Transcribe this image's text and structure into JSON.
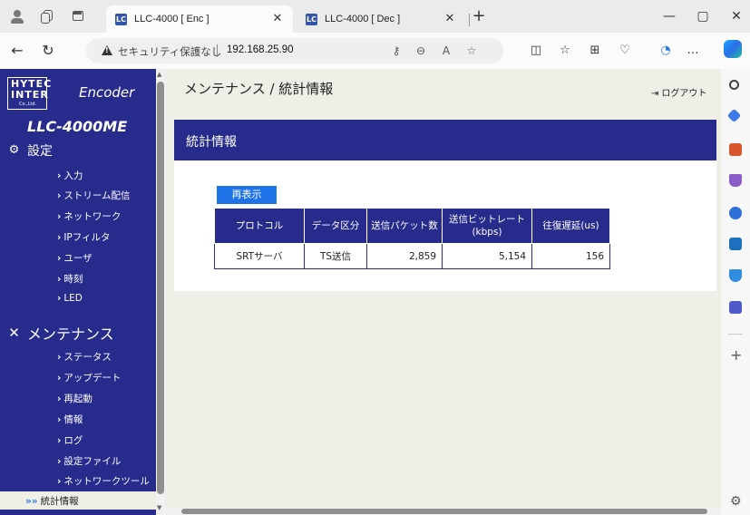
{
  "browser": {
    "tabs": [
      {
        "title": "LLC-4000 [ Enc ]",
        "favicon": "LC",
        "close": "✕"
      },
      {
        "title": "LLC-4000 [ Dec ]",
        "favicon": "LC",
        "close": "✕"
      }
    ],
    "new_tab": "+",
    "window_controls": {
      "minimize": "—",
      "maximize": "▢",
      "close": "✕"
    },
    "nav": {
      "back": "←",
      "reload": "↻"
    },
    "address": {
      "security_label": "セキュリティ保護なし",
      "url": "192.168.25.90"
    },
    "address_icons": {
      "key": "⚷",
      "zoom": "⊖",
      "read_aloud": "A",
      "favorite": "☆"
    },
    "toolbar_icons": {
      "split": "◫",
      "favorites": "☆",
      "collections": "⊞",
      "health": "♡",
      "performance": "◔",
      "more": "…"
    }
  },
  "sidebar": {
    "logo_line1": "HYTEC",
    "logo_line2": "INTER",
    "logo_line3": "Co.,Ltd.",
    "encoder_label": "Encoder",
    "model": "LLC-4000ME",
    "settings_heading": "設定",
    "settings_items": [
      "入力",
      "ストリーム配信",
      "ネットワーク",
      "IPフィルタ",
      "ユーザ",
      "時刻",
      "LED"
    ],
    "maintenance_heading": "メンテナンス",
    "maintenance_items": [
      "ステータス",
      "アップデート",
      "再起動",
      "情報",
      "ログ",
      "設定ファイル",
      "ネットワークツール"
    ],
    "current_item": "統計情報",
    "current_marker": "»»"
  },
  "main": {
    "breadcrumb": "メンテナンス / 統計情報",
    "logout": "ログアウト",
    "panel_title": "統計情報",
    "refresh_button": "再表示",
    "table": {
      "headers": [
        "プロトコル",
        "データ区分",
        "送信パケット数",
        "送信ビットレート",
        "(kbps)",
        "往復遅延(us)"
      ],
      "rows": [
        [
          "SRTサーバ",
          "TS送信",
          "2,859",
          "5,154",
          "156"
        ]
      ]
    }
  },
  "colors": {
    "brand": "#262b8c",
    "button": "#1e73e8",
    "page_bg": "#efefe7"
  }
}
